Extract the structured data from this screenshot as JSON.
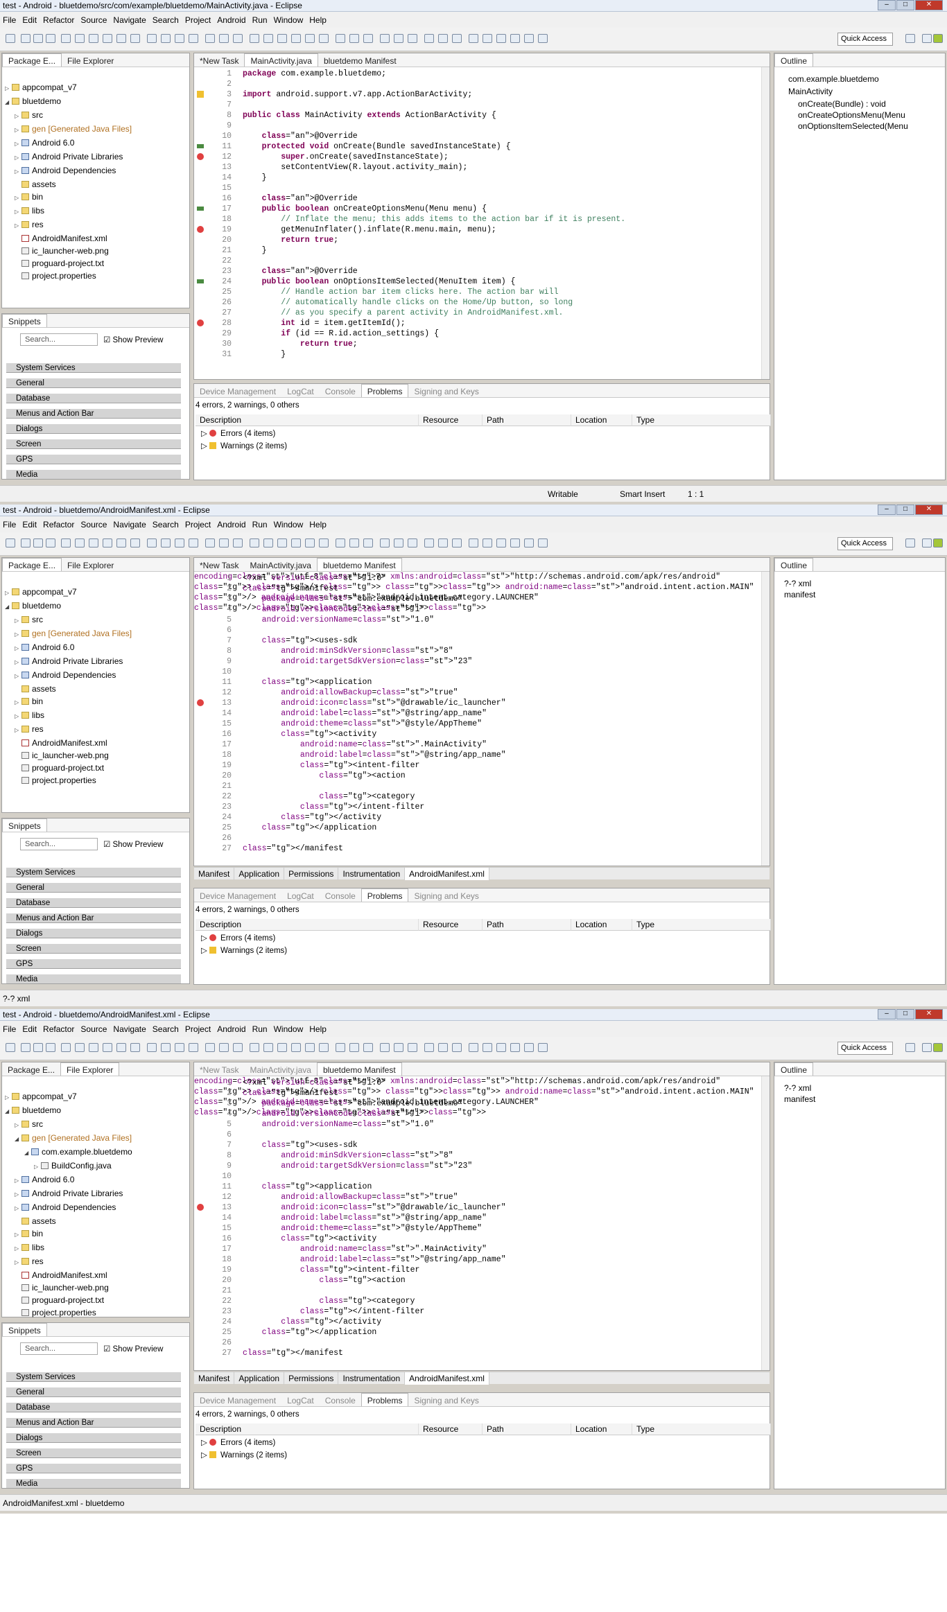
{
  "frames": [
    {
      "title": "test - Android - bluetdemo/src/com/example/bluetdemo/MainActivity.java - Eclipse",
      "editor_tabs": [
        "*New Task",
        "MainActivity.java",
        "bluetdemo Manifest"
      ],
      "editor_active": 1,
      "outline_items": [
        "com.example.bluetdemo",
        "MainActivity",
        "onCreate(Bundle) : void",
        "onCreateOptionsMenu(Menu",
        "onOptionsItemSelected(Menu"
      ],
      "status_left": "",
      "status_writable": "Writable",
      "status_insert": "Smart Insert",
      "status_pos": "1 : 1"
    },
    {
      "title": "test - Android - bluetdemo/AndroidManifest.xml - Eclipse",
      "editor_tabs": [
        "*New Task",
        "MainActivity.java",
        "bluetdemo Manifest"
      ],
      "editor_active": 2,
      "outline_items": [
        "?-? xml",
        "manifest"
      ],
      "status_left": "?-? xml"
    },
    {
      "title": "test - Android - bluetdemo/AndroidManifest.xml - Eclipse",
      "editor_tabs": [
        "*New Task",
        "MainActivity.java",
        "bluetdemo Manifest"
      ],
      "editor_active": 2,
      "outline_items": [
        "?-? xml",
        "manifest"
      ],
      "status_left": "AndroidManifest.xml - bluetdemo"
    }
  ],
  "menu": [
    "File",
    "Edit",
    "Refactor",
    "Source",
    "Navigate",
    "Search",
    "Project",
    "Android",
    "Run",
    "Window",
    "Help"
  ],
  "quick_access": "Quick Access",
  "left_tabs": [
    "Package E...",
    "File Explorer"
  ],
  "tree": [
    "appcompat_v7",
    "bluetdemo",
    "src",
    "gen [Generated Java Files]",
    "Android 6.0",
    "Android Private Libraries",
    "Android Dependencies",
    "assets",
    "bin",
    "libs",
    "res",
    "AndroidManifest.xml",
    "ic_launcher-web.png",
    "proguard-project.txt",
    "project.properties"
  ],
  "tree_gen_children": [
    "com.example.bluetdemo",
    "BuildConfig.java"
  ],
  "snippets": {
    "title": "Snippets",
    "search": "Search...",
    "show_preview": "Show Preview",
    "categories": [
      "System Services",
      "General",
      "Database",
      "Menus and Action Bar",
      "Dialogs",
      "Screen",
      "GPS",
      "Media"
    ]
  },
  "bottom_tabs": [
    "Device Management",
    "LogCat",
    "Console",
    "Problems",
    "Signing and Keys"
  ],
  "problems": {
    "summary": "4 errors, 2 warnings, 0 others",
    "columns": [
      "Description",
      "Resource",
      "Path",
      "Location",
      "Type"
    ],
    "errors": "Errors (4 items)",
    "warnings": "Warnings (2 items)"
  },
  "manifest_tabs": [
    "Manifest",
    "Application",
    "Permissions",
    "Instrumentation",
    "AndroidManifest.xml"
  ],
  "outline_title": "Outline",
  "java_code": [
    "package com.example.bluetdemo;",
    "",
    "import android.support.v7.app.ActionBarActivity;",
    "",
    "public class MainActivity extends ActionBarActivity {",
    "",
    "    @Override",
    "    protected void onCreate(Bundle savedInstanceState) {",
    "        super.onCreate(savedInstanceState);",
    "        setContentView(R.layout.activity_main);",
    "    }",
    "",
    "    @Override",
    "    public boolean onCreateOptionsMenu(Menu menu) {",
    "        // Inflate the menu; this adds items to the action bar if it is present.",
    "        getMenuInflater().inflate(R.menu.main, menu);",
    "        return true;",
    "    }",
    "",
    "    @Override",
    "    public boolean onOptionsItemSelected(MenuItem item) {",
    "        // Handle action bar item clicks here. The action bar will",
    "        // automatically handle clicks on the Home/Up button, so long",
    "        // as you specify a parent activity in AndroidManifest.xml.",
    "        int id = item.getItemId();",
    "        if (id == R.id.action_settings) {",
    "            return true;",
    "        }"
  ],
  "java_lines": [
    "1",
    "2",
    "3",
    "7",
    "8",
    "9",
    "10",
    "11",
    "12",
    "13",
    "14",
    "15",
    "16",
    "17",
    "18",
    "19",
    "20",
    "21",
    "22",
    "23",
    "24",
    "25",
    "26",
    "27",
    "28",
    "29",
    "30",
    "31"
  ],
  "xml_code": [
    "<?xml version=\"1.0\" encoding=\"utf-8\"?>",
    "<manifest xmlns:android=\"http://schemas.android.com/apk/res/android\"",
    "    package=\"com.example.bluetdemo\"",
    "    android:versionCode=\"1\"",
    "    android:versionName=\"1.0\" >",
    "",
    "    <uses-sdk",
    "        android:minSdkVersion=\"8\"",
    "        android:targetSdkVersion=\"23\" />",
    "",
    "    <application",
    "        android:allowBackup=\"true\"",
    "        android:icon=\"@drawable/ic_launcher\"",
    "        android:label=\"@string/app_name\"",
    "        android:theme=\"@style/AppTheme\" >",
    "        <activity",
    "            android:name=\".MainActivity\"",
    "            android:label=\"@string/app_name\" >",
    "            <intent-filter>",
    "                <action android:name=\"android.intent.action.MAIN\" />",
    "",
    "                <category android:name=\"android.intent.category.LAUNCHER\" />",
    "            </intent-filter>",
    "        </activity>",
    "    </application>",
    "",
    "</manifest>"
  ],
  "colors": {
    "error": "#e04040",
    "warning": "#f0c030",
    "keyword": "#7f0055",
    "comment": "#3f7f5f",
    "string": "#2a00ff"
  }
}
